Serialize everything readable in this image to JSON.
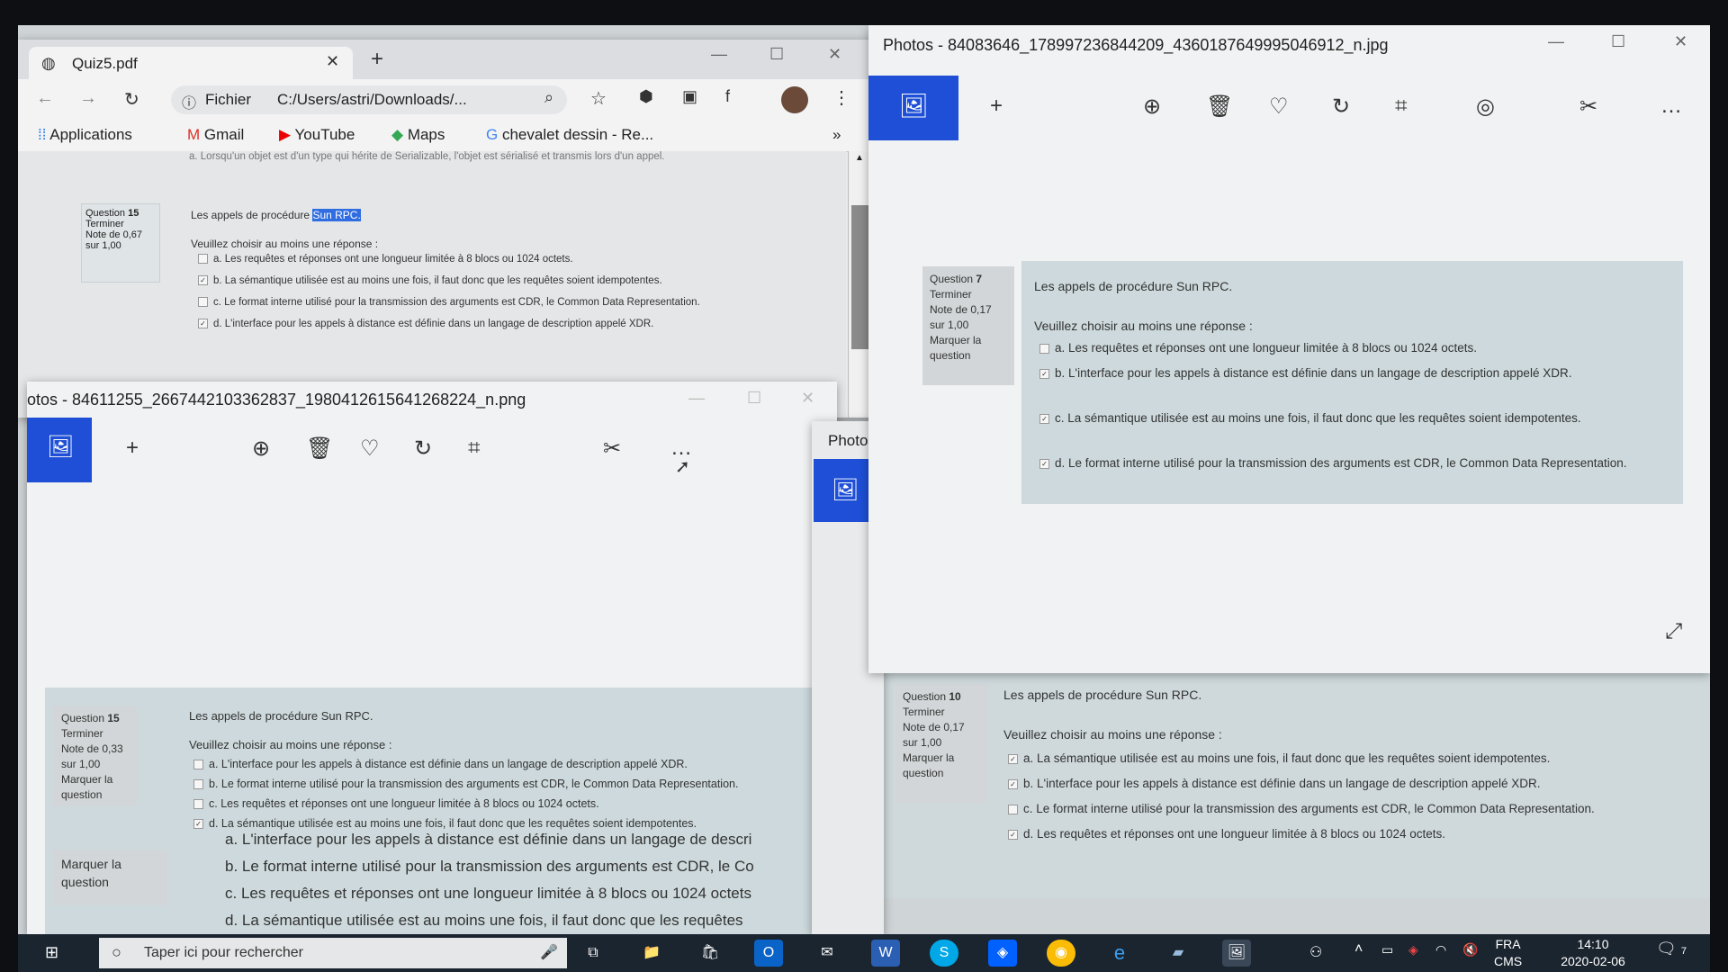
{
  "chrome": {
    "tab_title": "Quiz5.pdf",
    "address": "C:/Users/astri/Downloads/...",
    "address_prefix": "Fichier",
    "bookmarks": [
      "Applications",
      "Gmail",
      "YouTube",
      "Maps",
      "chevalet dessin - Re..."
    ],
    "bookmarks_more": "»",
    "pdf": {
      "top_line": "a. Lorsqu'un objet est d'un type qui hérite de Serializable, l'objet est sérialisé et transmis lors d'un appel.",
      "question_label": "Question",
      "question_number": "15",
      "status": "Terminer",
      "grade": "Note de 0,67 sur 1,00",
      "prompt": "Les appels de procédure",
      "prompt_highlight": "Sun RPC.",
      "instruction": "Veuillez choisir au moins une réponse :",
      "options": [
        {
          "text": "a. Les requêtes et réponses ont une longueur limitée à 8 blocs ou 1024 octets.",
          "checked": false
        },
        {
          "text": "b. La sémantique utilisée est au moins une fois, il faut donc que les requêtes soient idempotentes.",
          "checked": true
        },
        {
          "text": "c. Le format interne utilisé pour la transmission des arguments est CDR, le Common Data Representation.",
          "checked": false
        },
        {
          "text": "d. L'interface pour les appels à distance est définie dans un langage de description appelé XDR.",
          "checked": true
        }
      ]
    }
  },
  "photos_left": {
    "title": "otos - 84611255_2667442103362837_1980412615641268224_n.png",
    "question_label": "Question",
    "question_number": "15",
    "status": "Terminer",
    "grade": "Note de 0,33 sur 1,00",
    "flag": "Marquer la question",
    "prompt": "Les appels de procédure Sun RPC.",
    "instruction": "Veuillez choisir au moins une réponse :",
    "options": [
      {
        "text": "a. L'interface pour les appels à distance est définie dans un langage de description appelé XDR.",
        "checked": false
      },
      {
        "text": "b. Le format interne utilisé pour la transmission des arguments est CDR, le Common Data Representation.",
        "checked": false
      },
      {
        "text": "c. Les requêtes et réponses ont une longueur limitée à 8 blocs ou 1024 octets.",
        "checked": false
      },
      {
        "text": "d. La sémantique utilisée est au moins une fois, il faut donc que les requêtes soient idempotentes.",
        "checked": true
      }
    ],
    "zoom_flag": "Marquer la question",
    "zoom_options": [
      "a. L'interface pour les appels à distance est définie dans un langage de descri",
      "b. Le format interne utilisé pour la transmission des arguments est CDR, le Co",
      "c. Les requêtes et réponses ont une longueur limitée à 8 blocs ou 1024 octets",
      "d. La sémantique utilisée est au moins une fois, il faut donc que les requêtes"
    ]
  },
  "photos_mid": {
    "title": "Photos"
  },
  "photos_right": {
    "title": "Photos - 84083646_178997236844209_4360187649995046912_n.jpg",
    "question_label": "Question",
    "question_number": "7",
    "status": "Terminer",
    "grade": "Note de 0,17 sur 1,00",
    "flag": "Marquer la question",
    "prompt": "Les appels de procédure Sun RPC.",
    "instruction": "Veuillez choisir au moins une réponse :",
    "options": [
      {
        "text": "a. Les requêtes et réponses ont une longueur limitée à 8 blocs ou 1024 octets.",
        "checked": false
      },
      {
        "text": "b. L'interface pour les appels à distance est définie dans un langage de description appelé XDR.",
        "checked": true
      },
      {
        "text": "c. La sémantique utilisée est au moins une fois, il faut donc que les requêtes soient idempotentes.",
        "checked": true
      },
      {
        "text": "d. Le format interne utilisé pour la transmission des arguments est CDR, le Common Data Representation.",
        "checked": true
      }
    ]
  },
  "background_q10": {
    "question_label": "Question",
    "question_number": "10",
    "status": "Terminer",
    "grade": "Note de 0,17 sur 1,00",
    "flag": "Marquer la question",
    "prompt": "Les appels de procédure Sun RPC.",
    "instruction": "Veuillez choisir au moins une réponse :",
    "options": [
      {
        "text": "a. La sémantique utilisée est au moins une fois, il faut donc que les requêtes soient idempotentes.",
        "checked": true
      },
      {
        "text": "b. L'interface pour les appels à distance est définie dans un langage de description appelé XDR.",
        "checked": true
      },
      {
        "text": "c. Le format interne utilisé pour la transmission des arguments est CDR, le Common Data Representation.",
        "checked": false
      },
      {
        "text": "d. Les requêtes et réponses ont une longueur limitée à 8 blocs ou 1024 octets.",
        "checked": true
      }
    ]
  },
  "taskbar": {
    "search_placeholder": "Taper ici pour rechercher",
    "lang_top": "FRA",
    "lang_bottom": "CMS",
    "time": "14:10",
    "date": "2020-02-06",
    "notification_count": "7"
  },
  "colors": {
    "accent": "#1e4fd6",
    "panel": "#cdd9dc",
    "taskbar": "#1b2530"
  }
}
